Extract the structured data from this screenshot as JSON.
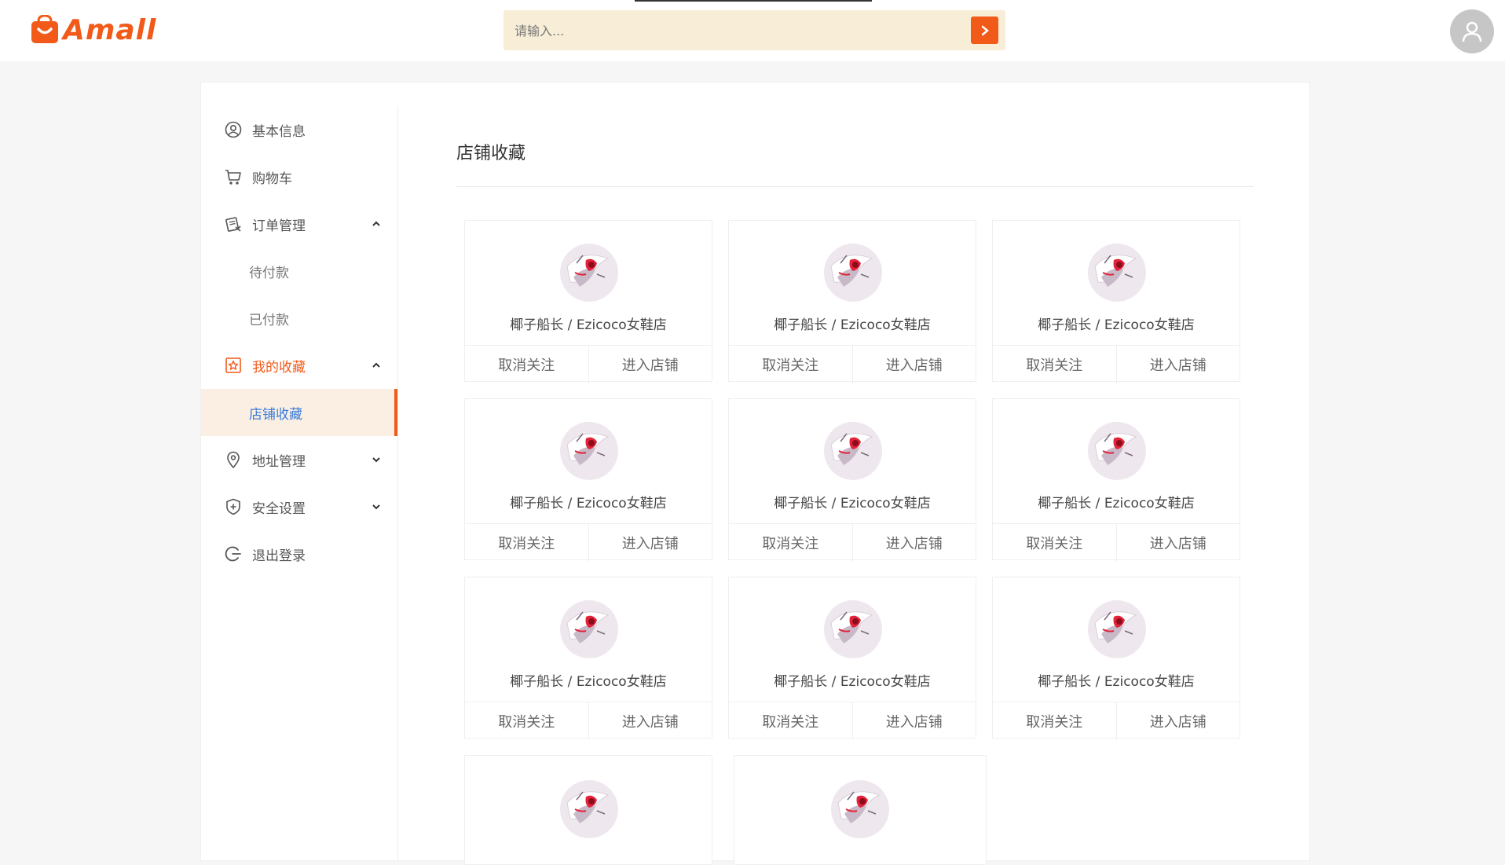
{
  "header": {
    "brand": "Amall",
    "search_placeholder": "请输入..."
  },
  "colors": {
    "accent": "#f25a1a",
    "search_bg": "#f8edd6",
    "active_bg": "#fbefe4",
    "active_text": "#3b7cd9"
  },
  "sidebar": {
    "items": [
      {
        "label": "基本信息",
        "icon": "user-circle-icon"
      },
      {
        "label": "购物车",
        "icon": "cart-icon"
      },
      {
        "label": "订单管理",
        "icon": "clipboard-icon",
        "expanded": true
      },
      {
        "label": "待付款"
      },
      {
        "label": "已付款"
      },
      {
        "label": "我的收藏",
        "icon": "star-icon",
        "expanded": true
      },
      {
        "label": "店铺收藏",
        "active": true
      },
      {
        "label": "地址管理",
        "icon": "location-pin-icon",
        "expanded": false
      },
      {
        "label": "安全设置",
        "icon": "shield-icon",
        "expanded": false
      },
      {
        "label": "退出登录",
        "icon": "logout-icon"
      }
    ]
  },
  "main": {
    "title": "店铺收藏",
    "shops": [
      {
        "name": "椰子船长 / Ezicoco女鞋店",
        "unfollow": "取消关注",
        "enter": "进入店铺"
      },
      {
        "name": "椰子船长 / Ezicoco女鞋店",
        "unfollow": "取消关注",
        "enter": "进入店铺"
      },
      {
        "name": "椰子船长 / Ezicoco女鞋店",
        "unfollow": "取消关注",
        "enter": "进入店铺"
      },
      {
        "name": "椰子船长 / Ezicoco女鞋店",
        "unfollow": "取消关注",
        "enter": "进入店铺"
      },
      {
        "name": "椰子船长 / Ezicoco女鞋店",
        "unfollow": "取消关注",
        "enter": "进入店铺"
      },
      {
        "name": "椰子船长 / Ezicoco女鞋店",
        "unfollow": "取消关注",
        "enter": "进入店铺"
      },
      {
        "name": "椰子船长 / Ezicoco女鞋店",
        "unfollow": "取消关注",
        "enter": "进入店铺"
      },
      {
        "name": "椰子船长 / Ezicoco女鞋店",
        "unfollow": "取消关注",
        "enter": "进入店铺"
      },
      {
        "name": "椰子船长 / Ezicoco女鞋店",
        "unfollow": "取消关注",
        "enter": "进入店铺"
      }
    ]
  }
}
